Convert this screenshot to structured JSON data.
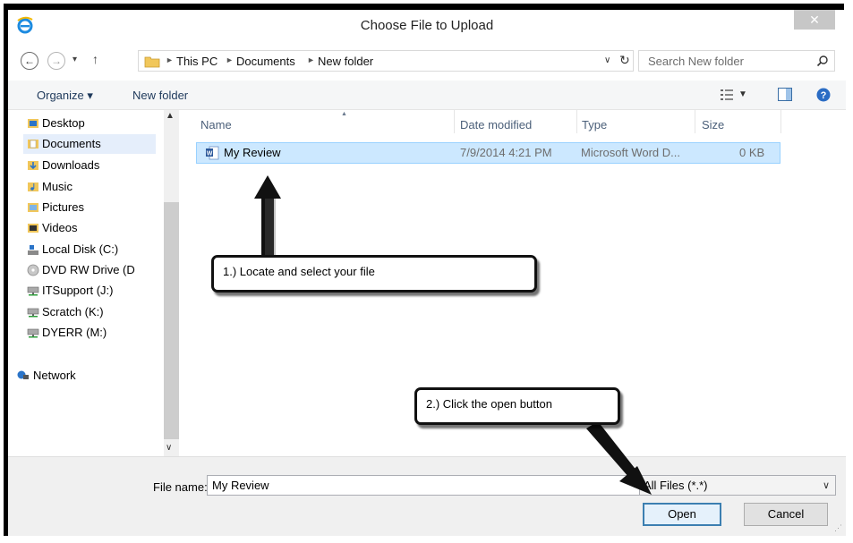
{
  "window": {
    "title": "Choose File to Upload",
    "close_glyph": "✕",
    "app_icon": "internet-explorer-icon"
  },
  "address_bar": {
    "breadcrumbs": [
      "This PC",
      "Documents",
      "New folder"
    ],
    "search_placeholder": "Search New folder"
  },
  "toolbar": {
    "organize_label": "Organize ▾",
    "new_folder_label": "New folder"
  },
  "nav_pane": {
    "items": [
      {
        "label": "Desktop",
        "icon": "desktop-folder-icon"
      },
      {
        "label": "Documents",
        "icon": "documents-folder-icon",
        "selected": true
      },
      {
        "label": "Downloads",
        "icon": "downloads-folder-icon"
      },
      {
        "label": "Music",
        "icon": "music-folder-icon"
      },
      {
        "label": "Pictures",
        "icon": "pictures-folder-icon"
      },
      {
        "label": "Videos",
        "icon": "videos-folder-icon"
      },
      {
        "label": "Local Disk (C:)",
        "icon": "local-disk-icon"
      },
      {
        "label": "DVD RW Drive (D",
        "icon": "dvd-drive-icon"
      },
      {
        "label": "ITSupport (J:)",
        "icon": "network-drive-icon"
      },
      {
        "label": "Scratch (K:)",
        "icon": "network-drive-icon"
      },
      {
        "label": "DYERR (M:)",
        "icon": "network-drive-icon"
      },
      {
        "label": "Network",
        "icon": "network-icon"
      }
    ]
  },
  "file_list": {
    "columns": [
      "Name",
      "Date modified",
      "Type",
      "Size"
    ],
    "rows": [
      {
        "name": "My Review",
        "date_modified": "7/9/2014 4:21 PM",
        "type": "Microsoft Word D...",
        "size": "0 KB",
        "selected": true
      }
    ]
  },
  "footer": {
    "file_name_label": "File name:",
    "file_name_value": "My Review",
    "filter_value": "All Files (*.*)",
    "open_label": "Open",
    "cancel_label": "Cancel"
  },
  "annotations": {
    "callout_1": "1.) Locate and select your file",
    "callout_2": "2.) Click the open button"
  },
  "colors": {
    "selection_fill": "#cce8ff",
    "selection_border": "#99d1ff",
    "primary_button_border": "#3c7fb1"
  }
}
